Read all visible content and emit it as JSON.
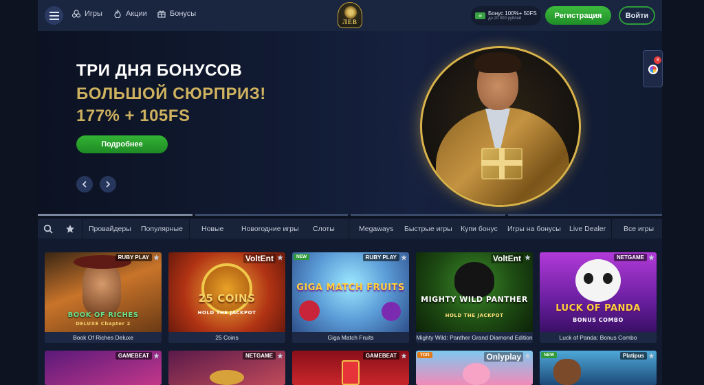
{
  "header": {
    "nav": [
      {
        "label": "Игры",
        "icon": "games-icon"
      },
      {
        "label": "Акции",
        "icon": "fire-icon"
      },
      {
        "label": "Бонусы",
        "icon": "gift-icon"
      }
    ],
    "logo_text": "ЛЕВ",
    "bonus_pill": {
      "main": "Бонус 100%+ 50FS",
      "sub": "до 20 000 рублей"
    },
    "register_label": "Регистрация",
    "login_label": "Войти"
  },
  "banner": {
    "line1": "ТРИ ДНЯ БОНУСОВ",
    "line2": "БОЛЬШОЙ СЮРПРИЗ!",
    "line3": "177% + 105FS",
    "button_label": "Подробнее",
    "accent_color": "#cfb25f"
  },
  "side_widget": {
    "badge": "3",
    "icon": "fortune-wheel-icon"
  },
  "categories": {
    "icons": [
      "search-icon",
      "star-icon"
    ],
    "items": [
      "Провайдеры",
      "Популярные",
      "Новые",
      "Новогодние игры",
      "Слоты",
      "Megaways",
      "Быстрые игры",
      "Купи бонус",
      "Игры на бонусы",
      "Live Dealer",
      "Все игры"
    ]
  },
  "games": [
    {
      "name": "Book Of Riches Deluxe",
      "provider": "RUBY PLAY",
      "thumb_title": "BOOK OF RICHES",
      "thumb_sub": "DELUXE Chapter 2"
    },
    {
      "name": "25 Coins",
      "provider": "VoltEnt",
      "thumb_title": "25 COINS",
      "thumb_sub": "HOLD THE JACKPOT"
    },
    {
      "name": "Giga Match Fruits",
      "provider": "RUBY PLAY",
      "tag": "NEW",
      "thumb_title": "GIGA MATCH FRUITS",
      "thumb_sub": ""
    },
    {
      "name": "Mighty Wild: Panther Grand Diamond Edition",
      "provider": "VoltEnt",
      "thumb_title": "MIGHTY WILD PANTHER",
      "thumb_sub": "HOLD THE JACKPOT"
    },
    {
      "name": "Luck of Panda: Bonus Combo",
      "provider": "NETGAME",
      "thumb_title": "LUCK OF PANDA",
      "thumb_sub": "BONUS COMBO"
    }
  ],
  "games_row2": [
    {
      "provider": "GAMEBEAT"
    },
    {
      "provider": "NETGAME"
    },
    {
      "provider": "GAMEBEAT"
    },
    {
      "provider": "Onlyplay",
      "tag": "ТОП"
    },
    {
      "provider": "Platipus",
      "tag": "NEW"
    }
  ]
}
